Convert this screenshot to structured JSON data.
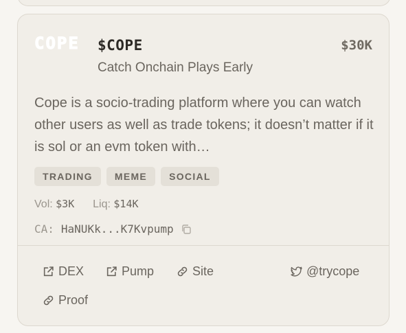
{
  "token": {
    "logo_text": "COPE",
    "ticker": "$COPE",
    "market_cap": "$30K",
    "tagline": "Catch Onchain Plays Early",
    "description": "Cope is a socio-trading platform where you can watch other users as well as trade tokens; it doesn’t matter if it is sol or an evm token with…",
    "tags": [
      "TRADING",
      "MEME",
      "SOCIAL"
    ],
    "volume_label": "Vol:",
    "volume": "$3K",
    "liquidity_label": "Liq:",
    "liquidity": "$14K",
    "ca_label": "CA:",
    "ca_value": "HaNUKk...K7Kvpump"
  },
  "links": {
    "dex": "DEX",
    "pump": "Pump",
    "site": "Site",
    "twitter": "@trycope",
    "proof": "Proof"
  },
  "icons": [
    "external-link-icon",
    "link-icon",
    "twitter-icon",
    "copy-icon"
  ]
}
